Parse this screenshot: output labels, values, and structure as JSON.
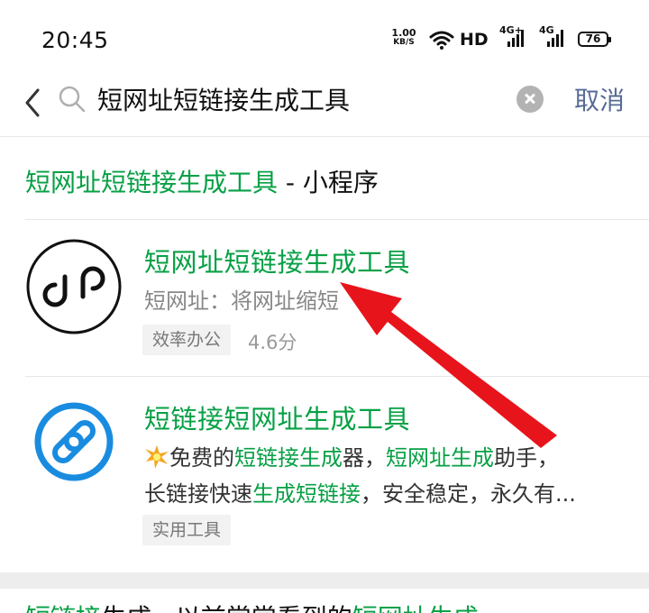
{
  "status_bar": {
    "time": "20:45",
    "net_speed_value": "1.00",
    "net_speed_unit": "KB/S",
    "hd_label": "HD",
    "network_1": "4G+",
    "network_2": "4G",
    "battery": "76"
  },
  "search": {
    "query": "短网址短链接生成工具",
    "cancel_label": "取消"
  },
  "section": {
    "title_highlight": "短网址短链接生成工具",
    "title_suffix": " - 小程序"
  },
  "results": [
    {
      "title": "短网址短链接生成工具",
      "description": "短网址：将网址缩短",
      "tag": "效率办公",
      "score": "4.6分"
    },
    {
      "title": "短链接短网址生成工具",
      "desc1_parts": [
        "免费的",
        "短链接生成",
        "器，",
        "短网址生成",
        "助手，"
      ],
      "desc2_parts": [
        "长链接快速",
        "生成短链接",
        "，安全稳定，永久有..."
      ],
      "tag": "实用工具"
    }
  ],
  "next_result_snippet": [
    "短链接",
    "生成...以前常常看到的",
    "短网址生成"
  ],
  "colors": {
    "accent_green": "#07a045",
    "link_blue": "#576b95",
    "arrow_red": "#e8141b",
    "icon_blue": "#1a8ce0"
  },
  "icons": [
    "back-arrow-icon",
    "search-icon",
    "clear-icon",
    "wifi-icon",
    "signal-icon",
    "mini-program-logo-icon",
    "chain-link-icon",
    "sparkle-icon"
  ]
}
